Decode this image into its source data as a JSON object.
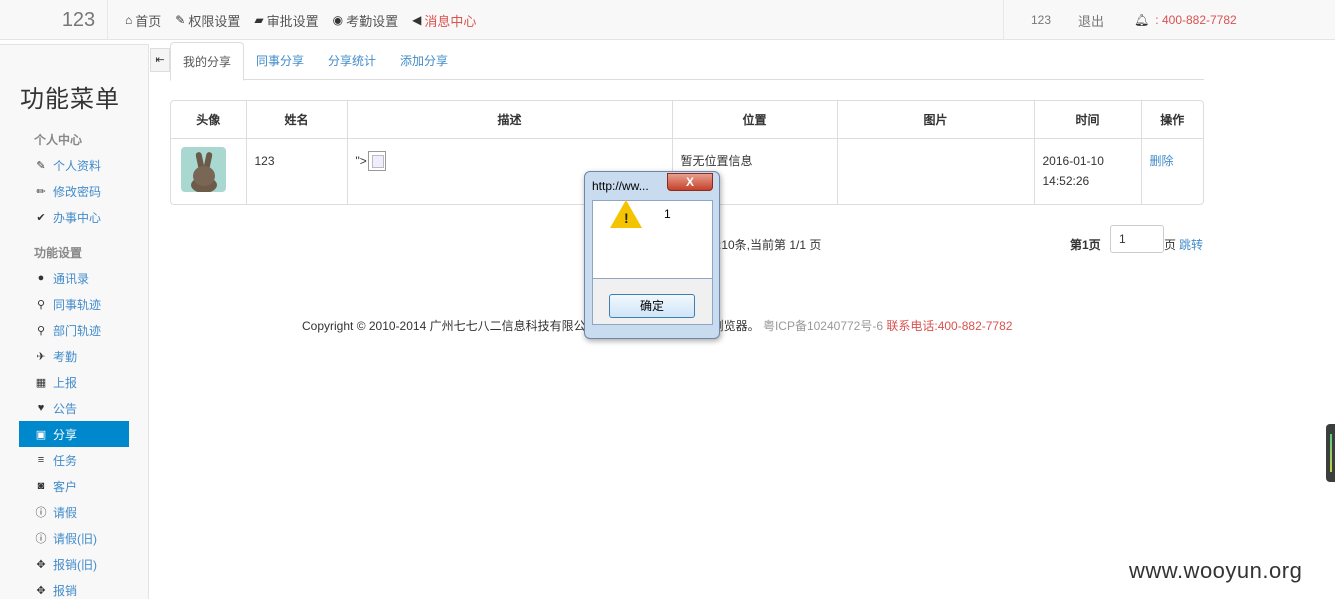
{
  "navbar": {
    "brand": "123",
    "items": [
      {
        "icon": "home-icon",
        "glyph": "⌂",
        "label": "首页"
      },
      {
        "icon": "wrench-icon",
        "glyph": "✎",
        "label": "权限设置"
      },
      {
        "icon": "folder-open-icon",
        "glyph": "▰",
        "label": "审批设置"
      },
      {
        "icon": "globe-icon",
        "glyph": "◉",
        "label": "考勤设置"
      },
      {
        "icon": "bullhorn-icon",
        "glyph": "◀",
        "label": "消息中心"
      }
    ],
    "user": "123",
    "logout": "退出",
    "phone": "400-882-7782",
    "phone_prefix": ":"
  },
  "sidebar": {
    "title": "功能菜单",
    "groups": [
      {
        "label": "个人中心",
        "items": [
          {
            "icon": "edit-icon",
            "glyph": "✎",
            "label": "个人资料"
          },
          {
            "icon": "pencil-icon",
            "glyph": "✏",
            "label": "修改密码"
          },
          {
            "icon": "check-circle-icon",
            "glyph": "✔",
            "label": "办事中心"
          }
        ]
      },
      {
        "label": "功能设置",
        "items": [
          {
            "icon": "user-icon",
            "glyph": "●",
            "label": "通讯录"
          },
          {
            "icon": "map-marker-icon",
            "glyph": "⚲",
            "label": "同事轨迹"
          },
          {
            "icon": "map-marker-icon",
            "glyph": "⚲",
            "label": "部门轨迹"
          },
          {
            "icon": "pushpin-icon",
            "glyph": "✈",
            "label": "考勤"
          },
          {
            "icon": "calendar-icon",
            "glyph": "▦",
            "label": "上报"
          },
          {
            "icon": "heart-icon",
            "glyph": "♥",
            "label": "公告"
          },
          {
            "icon": "gift-icon",
            "glyph": "▣",
            "label": "分享"
          },
          {
            "icon": "list-icon",
            "glyph": "≡",
            "label": "任务"
          },
          {
            "icon": "camera-icon",
            "glyph": "◙",
            "label": "客户"
          },
          {
            "icon": "info-sign-icon",
            "glyph": "ⓘ",
            "label": "请假"
          },
          {
            "icon": "info-sign-icon",
            "glyph": "ⓘ",
            "label": "请假(旧)"
          },
          {
            "icon": "move-icon",
            "glyph": "✥",
            "label": "报销(旧)"
          },
          {
            "icon": "move-icon",
            "glyph": "✥",
            "label": "报销"
          }
        ]
      }
    ]
  },
  "tabs": [
    "我的分享",
    "同事分享",
    "分享统计",
    "添加分享"
  ],
  "table": {
    "headers": [
      "头像",
      "姓名",
      "描述",
      "位置",
      "图片",
      "时间",
      "操作"
    ],
    "row": {
      "name": "123",
      "desc": "\">",
      "location": "暂无位置信息",
      "time_date": "2016-01-10",
      "time_clock": "14:52:26",
      "action": "删除"
    }
  },
  "pagination": {
    "info": "示:10条,当前第 1/1 页",
    "current": "第1页",
    "input_value": "1",
    "suffix": "页",
    "jump": "跳转"
  },
  "footer": {
    "copyright": "Copyright © 2010-2014 广州七七八二信息科技有限公",
    "browser": "浏览器。",
    "icp": "粤ICP备10240772号-6",
    "contact": "联系电话:400-882-7782"
  },
  "dialog": {
    "title": "http://ww...",
    "close": "X",
    "message": "1",
    "ok": "确定"
  },
  "watermark": "www.wooyun.org",
  "colors": {
    "accent": "#0088cc",
    "alert": "#d9534f",
    "link": "#428bca"
  }
}
